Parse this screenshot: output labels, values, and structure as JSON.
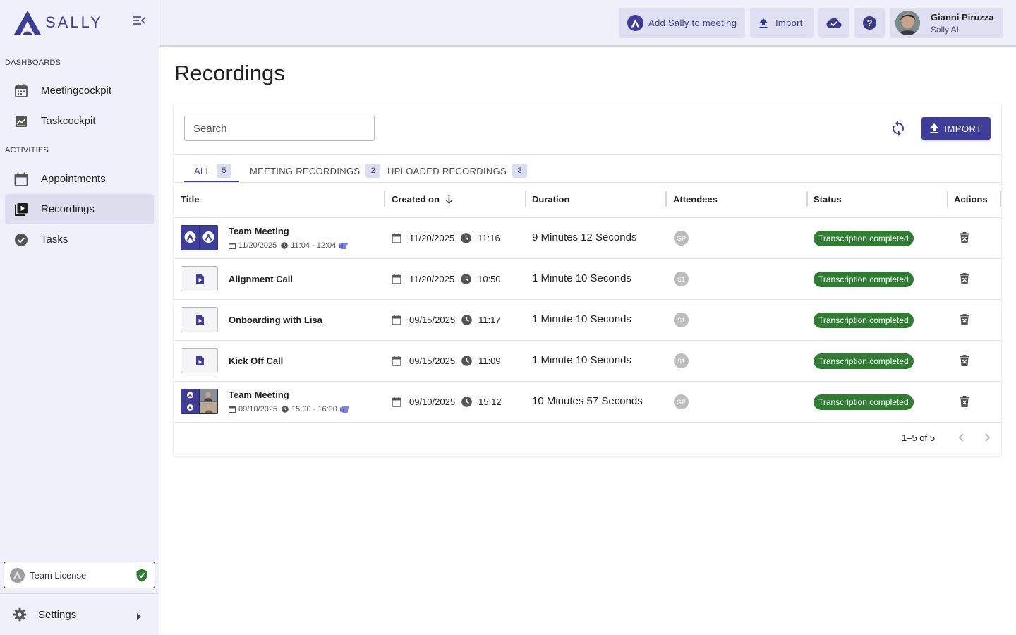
{
  "brand": {
    "name": "SALLY"
  },
  "sidebar": {
    "sections": [
      {
        "label": "DASHBOARDS"
      },
      {
        "label": "ACTIVITIES"
      }
    ],
    "items": [
      {
        "label": "Meetingcockpit",
        "icon": "calendar-icon"
      },
      {
        "label": "Taskcockpit",
        "icon": "chart-icon"
      },
      {
        "label": "Appointments",
        "icon": "calendar-blank-icon"
      },
      {
        "label": "Recordings",
        "icon": "video-library-icon",
        "active": true
      },
      {
        "label": "Tasks",
        "icon": "check-circle-icon"
      }
    ],
    "license": {
      "label": "Team License"
    },
    "settings": {
      "label": "Settings"
    }
  },
  "topbar": {
    "add_to_meeting": "Add Sally to meeting",
    "import": "Import",
    "user": {
      "name": "Gianni Piruzza",
      "role": "Sally AI"
    }
  },
  "page": {
    "title": "Recordings"
  },
  "toolbar": {
    "search_placeholder": "Search",
    "import_label": "IMPORT"
  },
  "tabs": [
    {
      "label": "ALL",
      "count": "5",
      "active": true
    },
    {
      "label": "MEETING RECORDINGS",
      "count": "2"
    },
    {
      "label": "UPLOADED RECORDINGS",
      "count": "3"
    }
  ],
  "table": {
    "columns": [
      "Title",
      "Created on",
      "Duration",
      "Attendees",
      "Status",
      "Actions"
    ],
    "rows": [
      {
        "title": "Team Meeting",
        "type": "meeting",
        "sub_date": "11/20/2025",
        "sub_time": "11:04 - 12:04",
        "date": "11/20/2025",
        "time": "11:16",
        "duration": "9 Minutes 12 Seconds",
        "attendee": "GP",
        "status": "Transcription completed"
      },
      {
        "title": "Alignment Call",
        "type": "upload",
        "date": "11/20/2025",
        "time": "10:50",
        "duration": "1 Minute 10 Seconds",
        "attendee": "S1",
        "status": "Transcription completed"
      },
      {
        "title": "Onboarding with Lisa",
        "type": "upload",
        "date": "09/15/2025",
        "time": "11:17",
        "duration": "1 Minute 10 Seconds",
        "attendee": "S1",
        "status": "Transcription completed"
      },
      {
        "title": "Kick Off Call",
        "type": "upload",
        "date": "09/15/2025",
        "time": "11:09",
        "duration": "1 Minute 10 Seconds",
        "attendee": "S1",
        "status": "Transcription completed"
      },
      {
        "title": "Team Meeting",
        "type": "meeting",
        "sub_date": "09/10/2025",
        "sub_time": "15:00 - 16:00",
        "date": "09/10/2025",
        "time": "15:12",
        "duration": "10 Minutes 57 Seconds",
        "attendee": "GP",
        "status": "Transcription completed"
      }
    ]
  },
  "pagination": {
    "label": "1–5 of 5"
  },
  "colors": {
    "accent": "#3f3d9a",
    "status_green": "#2e7d32",
    "sidebar_bg": "#eff0fa",
    "teams_purple": "#5059c9"
  }
}
